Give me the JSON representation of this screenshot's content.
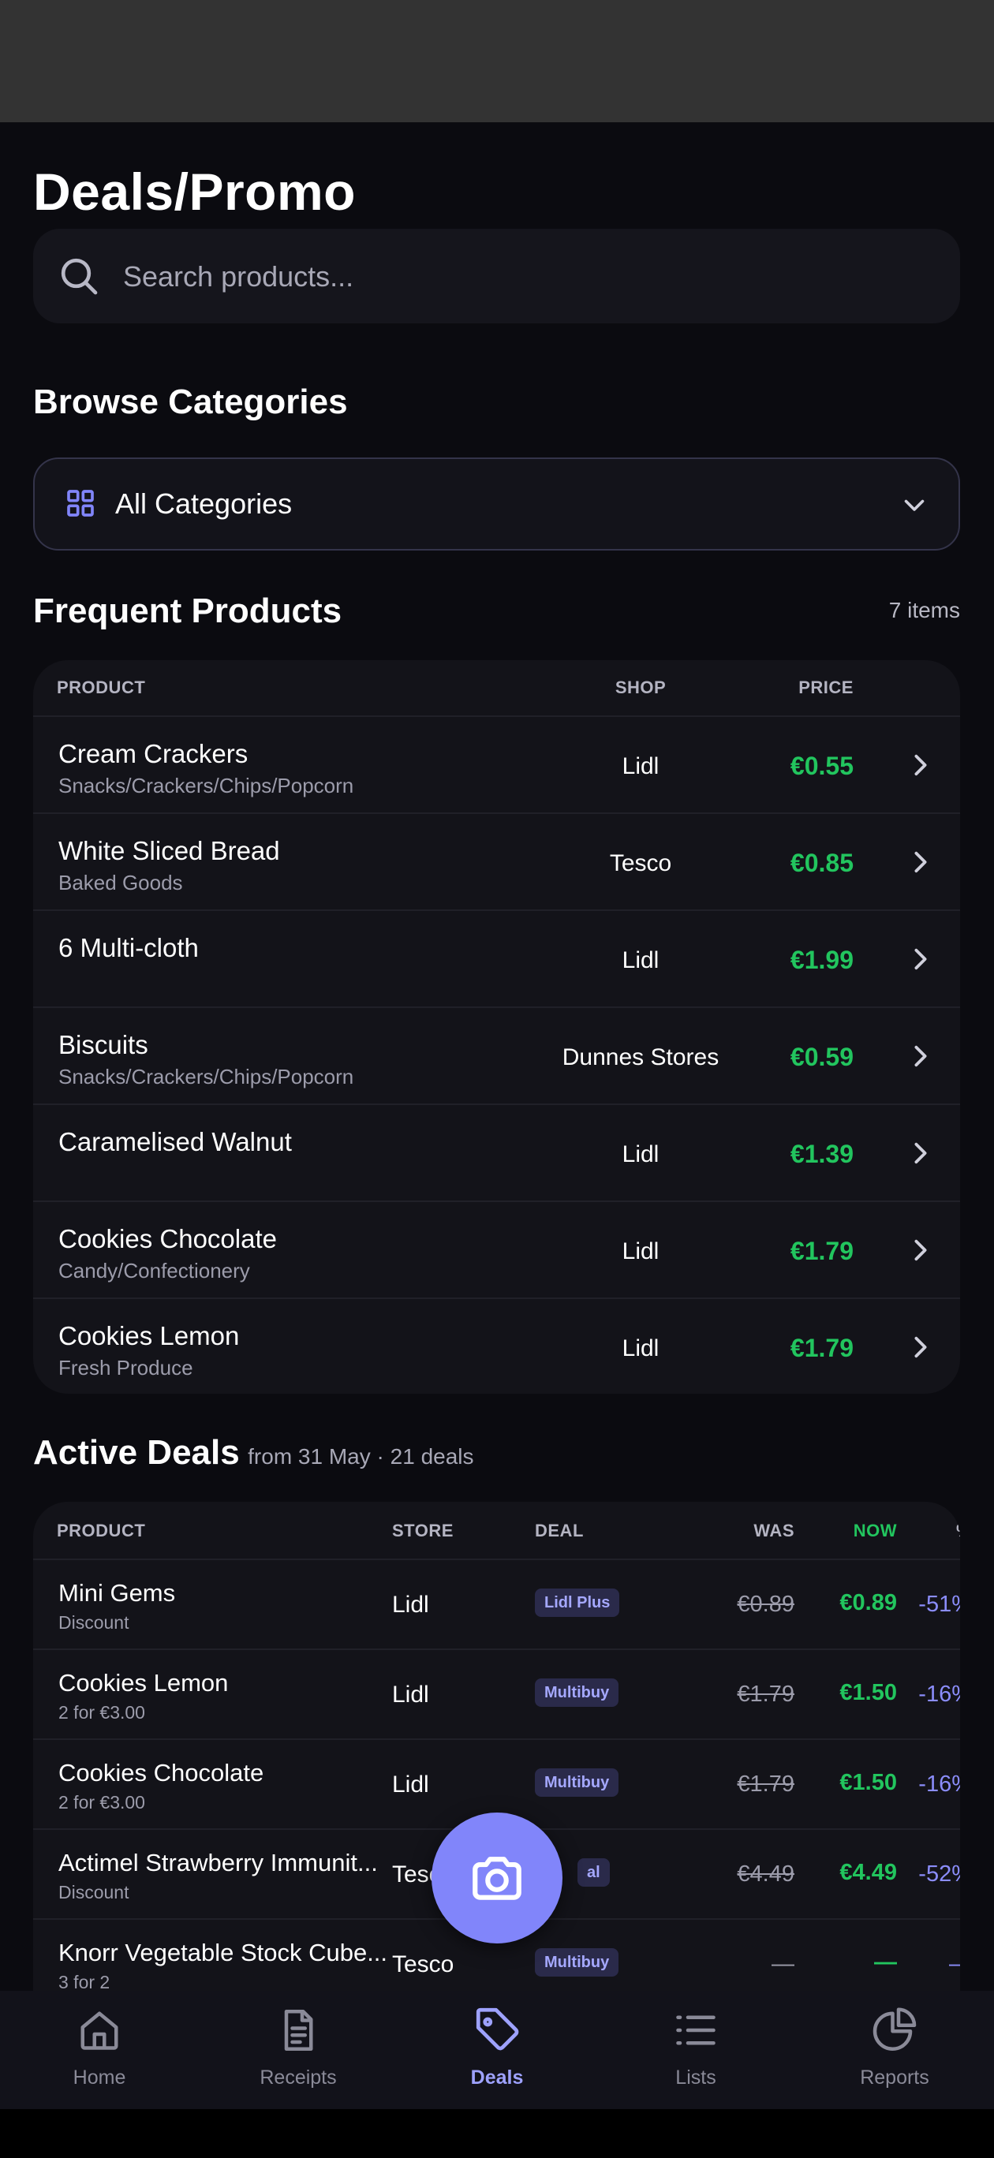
{
  "page": {
    "title": "Deals/Promo",
    "search_placeholder": "Search products..."
  },
  "categories": {
    "heading": "Browse Categories",
    "selected": "All Categories"
  },
  "frequent": {
    "heading": "Frequent Products",
    "count": "7 items",
    "columns": {
      "product": "PRODUCT",
      "shop": "SHOP",
      "price": "PRICE"
    },
    "rows": [
      {
        "name": "Cream Crackers",
        "category": "Snacks/Crackers/Chips/Popcorn",
        "shop": "Lidl",
        "price": "€0.55"
      },
      {
        "name": "White Sliced Bread",
        "category": "Baked Goods",
        "shop": "Tesco",
        "price": "€0.85"
      },
      {
        "name": "6 Multi-cloth",
        "category": "",
        "shop": "Lidl",
        "price": "€1.99"
      },
      {
        "name": "Biscuits",
        "category": "Snacks/Crackers/Chips/Popcorn",
        "shop": "Dunnes Stores",
        "price": "€0.59"
      },
      {
        "name": "Caramelised Walnut",
        "category": "",
        "shop": "Lidl",
        "price": "€1.39"
      },
      {
        "name": "Cookies Chocolate",
        "category": "Candy/Confectionery",
        "shop": "Lidl",
        "price": "€1.79"
      },
      {
        "name": "Cookies Lemon",
        "category": "Fresh Produce",
        "shop": "Lidl",
        "price": "€1.79"
      }
    ]
  },
  "deals": {
    "heading": "Active Deals",
    "subtitle": "from 31 May · 21 deals",
    "columns": {
      "product": "PRODUCT",
      "store": "STORE",
      "deal": "DEAL",
      "was": "WAS",
      "now": "NOW",
      "pct": "%"
    },
    "rows": [
      {
        "name": "Mini Gems",
        "sub": "Discount",
        "store": "Lidl",
        "deal": "Lidl Plus",
        "was": "€0.89",
        "now": "€0.89",
        "pct": "-51%"
      },
      {
        "name": "Cookies Lemon",
        "sub": "2 for €3.00",
        "store": "Lidl",
        "deal": "Multibuy",
        "was": "€1.79",
        "now": "€1.50",
        "pct": "-16%"
      },
      {
        "name": "Cookies Chocolate",
        "sub": "2 for €3.00",
        "store": "Lidl",
        "deal": "Multibuy",
        "was": "€1.79",
        "now": "€1.50",
        "pct": "-16%"
      },
      {
        "name": "Actimel Strawberry Immunit...",
        "sub": "Discount",
        "store": "Tesc",
        "deal": "al",
        "was": "€4.49",
        "now": "€4.49",
        "pct": "-52%"
      },
      {
        "name": "Knorr Vegetable Stock Cube...",
        "sub": "3 for 2",
        "store": "Tesco",
        "deal": "Multibuy",
        "was": "—",
        "now": "—",
        "pct": "—"
      }
    ]
  },
  "nav": {
    "home": "Home",
    "receipts": "Receipts",
    "deals": "Deals",
    "lists": "Lists",
    "reports": "Reports"
  },
  "colors": {
    "accent": "#8185fa",
    "price_green": "#22c55e",
    "background": "#0b0b10"
  }
}
